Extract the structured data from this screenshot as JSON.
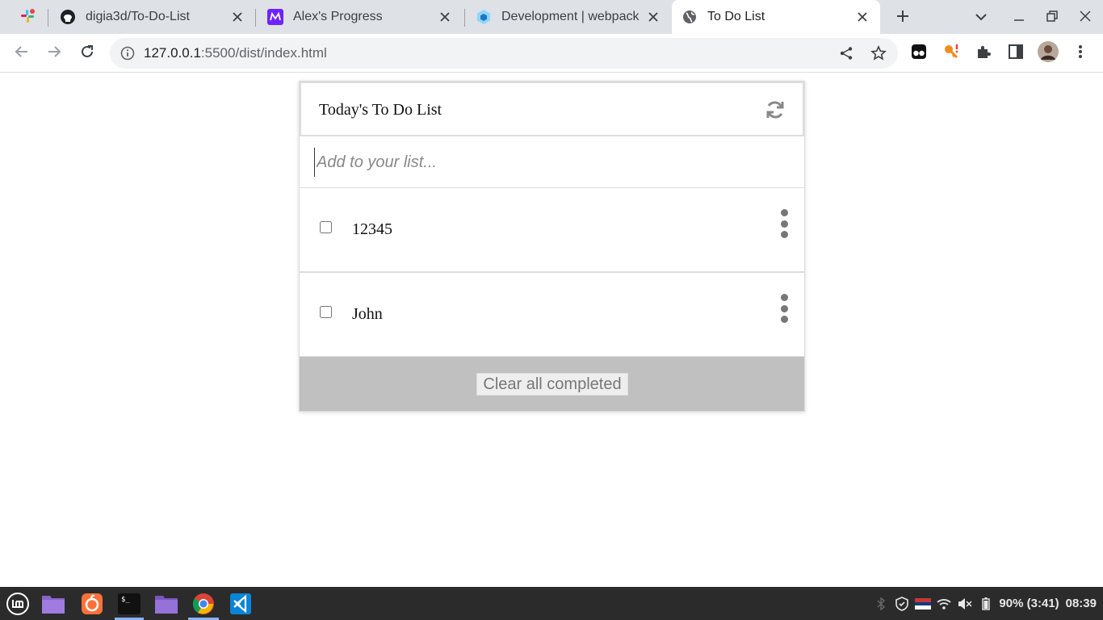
{
  "browser": {
    "tabs": [
      {
        "title": "digia3d/To-Do-List",
        "icon": "github-icon"
      },
      {
        "title": "Alex's Progress",
        "icon": "microverse-icon"
      },
      {
        "title": "Development | webpack",
        "icon": "webpack-icon"
      },
      {
        "title": "To Do List",
        "icon": "globe-icon",
        "active": true
      }
    ],
    "pinned_tab_icon": "slack-icon",
    "url_host": "127.0.0.1",
    "url_rest": ":5500/dist/index.html"
  },
  "app": {
    "title": "Today's To Do List",
    "add_placeholder": "Add to your list...",
    "items": [
      {
        "text": "12345",
        "completed": false
      },
      {
        "text": "John",
        "completed": false
      }
    ],
    "clear_label": "Clear all completed"
  },
  "taskbar": {
    "apps": [
      "mint-menu-icon",
      "folder-icon",
      "firefox-icon",
      "terminal-icon",
      "files-icon",
      "chrome-icon",
      "vscode-icon"
    ],
    "battery": "90% (3:41)",
    "clock": "08:39"
  },
  "colors": {
    "tabbar_bg": "#dee1e6",
    "footer_bg": "#c0c0c0",
    "taskbar_bg": "#2b2b2b"
  }
}
